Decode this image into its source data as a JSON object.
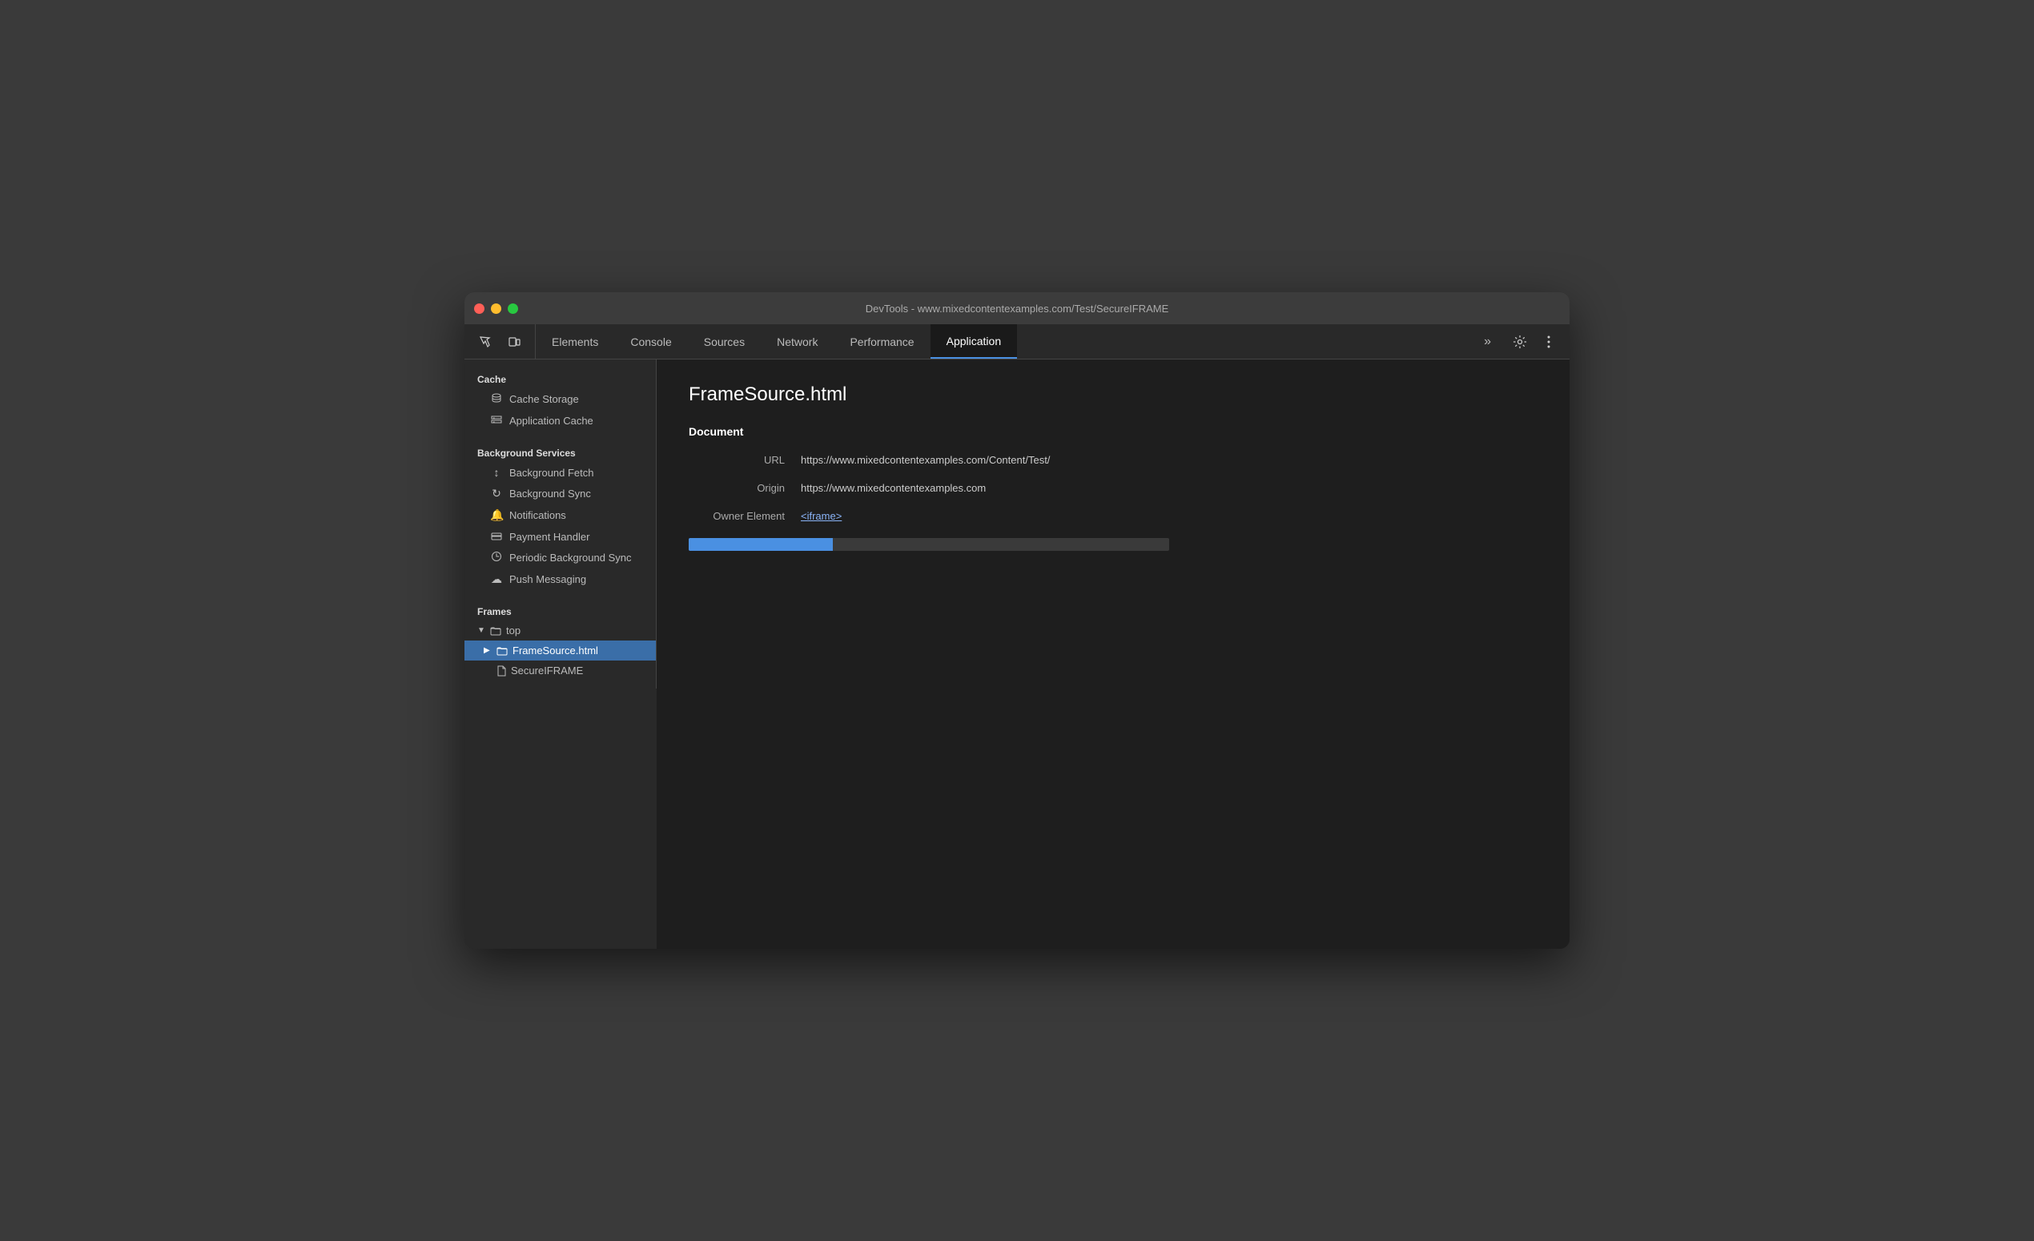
{
  "window": {
    "title": "DevTools - www.mixedcontentexamples.com/Test/SecureIFRAME"
  },
  "tabs": {
    "items": [
      {
        "id": "elements",
        "label": "Elements",
        "active": false
      },
      {
        "id": "console",
        "label": "Console",
        "active": false
      },
      {
        "id": "sources",
        "label": "Sources",
        "active": false
      },
      {
        "id": "network",
        "label": "Network",
        "active": false
      },
      {
        "id": "performance",
        "label": "Performance",
        "active": false
      },
      {
        "id": "application",
        "label": "Application",
        "active": true
      }
    ],
    "more_label": "»"
  },
  "sidebar": {
    "sections": [
      {
        "id": "cache",
        "header": "Cache",
        "items": [
          {
            "id": "cache-storage",
            "label": "Cache Storage",
            "icon": "🗄"
          },
          {
            "id": "application-cache",
            "label": "Application Cache",
            "icon": "▦"
          }
        ]
      },
      {
        "id": "background-services",
        "header": "Background Services",
        "items": [
          {
            "id": "background-fetch",
            "label": "Background Fetch",
            "icon": "↕"
          },
          {
            "id": "background-sync",
            "label": "Background Sync",
            "icon": "↻"
          },
          {
            "id": "notifications",
            "label": "Notifications",
            "icon": "🔔"
          },
          {
            "id": "payment-handler",
            "label": "Payment Handler",
            "icon": "▬"
          },
          {
            "id": "periodic-background-sync",
            "label": "Periodic Background Sync",
            "icon": "🕐"
          },
          {
            "id": "push-messaging",
            "label": "Push Messaging",
            "icon": "☁"
          }
        ]
      },
      {
        "id": "frames",
        "header": "Frames"
      }
    ],
    "frames": [
      {
        "id": "top",
        "label": "top",
        "level": 0,
        "expanded": true,
        "has_chevron": true
      },
      {
        "id": "framesource",
        "label": "FrameSource.html",
        "level": 1,
        "expanded": false,
        "has_chevron": true,
        "selected": true
      },
      {
        "id": "secureiframe",
        "label": "SecureIFRAME",
        "level": 2,
        "expanded": false,
        "has_chevron": false
      }
    ]
  },
  "content": {
    "page_title": "FrameSource.html",
    "section_header": "Document",
    "fields": [
      {
        "label": "URL",
        "value": "https://www.mixedcontentexamples.com/Content/Test/",
        "is_link": false
      },
      {
        "label": "Origin",
        "value": "https://www.mixedcontentexamples.com",
        "is_link": false
      },
      {
        "label": "Owner Element",
        "value": "<iframe>",
        "is_link": true
      }
    ]
  }
}
